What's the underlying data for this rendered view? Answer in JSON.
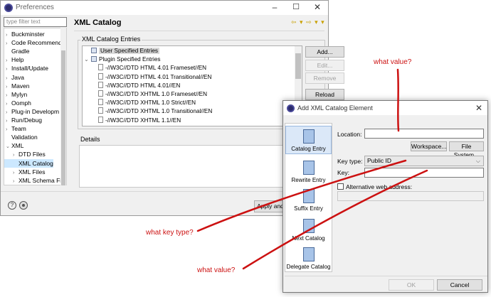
{
  "preferences": {
    "title": "Preferences",
    "filter_placeholder": "type filter text",
    "tree": [
      {
        "label": "Buckminster",
        "expandable": true
      },
      {
        "label": "Code Recommend",
        "expandable": true
      },
      {
        "label": "Gradle",
        "expandable": false
      },
      {
        "label": "Help",
        "expandable": true
      },
      {
        "label": "Install/Update",
        "expandable": true
      },
      {
        "label": "Java",
        "expandable": true
      },
      {
        "label": "Maven",
        "expandable": true
      },
      {
        "label": "Mylyn",
        "expandable": true
      },
      {
        "label": "Oomph",
        "expandable": true
      },
      {
        "label": "Plug-in Developm",
        "expandable": true
      },
      {
        "label": "Run/Debug",
        "expandable": true
      },
      {
        "label": "Team",
        "expandable": true
      },
      {
        "label": "Validation",
        "expandable": false
      },
      {
        "label": "XML",
        "expanded": true
      },
      {
        "label": "DTD Files",
        "child": true,
        "expandable": true
      },
      {
        "label": "XML Catalog",
        "child": true,
        "selected": true
      },
      {
        "label": "XML Files",
        "child": true,
        "expandable": true
      },
      {
        "label": "XML Schema Fi",
        "child": true,
        "expandable": true
      }
    ],
    "page_title": "XML Catalog",
    "catalog_group_label": "XML Catalog Entries",
    "entries": [
      {
        "label": "User Specified Entries",
        "level": 0,
        "type": "folder",
        "selected": true
      },
      {
        "label": "Plugin Specified Entries",
        "level": 0,
        "type": "folder",
        "expanded": true
      },
      {
        "label": "-//W3C//DTD HTML 4.01 Frameset//EN",
        "level": 1,
        "type": "doc"
      },
      {
        "label": "-//W3C//DTD HTML 4.01 Transitional//EN",
        "level": 1,
        "type": "doc"
      },
      {
        "label": "-//W3C//DTD HTML 4.01//EN",
        "level": 1,
        "type": "doc"
      },
      {
        "label": "-//W3C//DTD XHTML 1.0 Frameset//EN",
        "level": 1,
        "type": "doc"
      },
      {
        "label": "-//W3C//DTD XHTML 1.0 Strict//EN",
        "level": 1,
        "type": "doc"
      },
      {
        "label": "-//W3C//DTD XHTML 1.0 Transitional//EN",
        "level": 1,
        "type": "doc"
      },
      {
        "label": "-//W3C//DTD XHTML 1.1//EN",
        "level": 1,
        "type": "doc"
      }
    ],
    "buttons": {
      "add": "Add...",
      "edit": "Edit...",
      "remove": "Remove",
      "reload": "Reload Entries",
      "apply": "Apply and"
    },
    "details_label": "Details"
  },
  "dialog": {
    "title": "Add XML Catalog Element",
    "sidebar": [
      {
        "label": "Catalog Entry",
        "selected": true
      },
      {
        "label": "Rewrite Entry"
      },
      {
        "label": "Suffix Entry"
      },
      {
        "label": "Next Catalog"
      },
      {
        "label": "Delegate Catalog"
      }
    ],
    "location_label": "Location:",
    "location_value": "",
    "workspace_button": "Workspace...",
    "filesystem_button": "File System...",
    "keytype_label": "Key type:",
    "keytype_value": "Public ID",
    "key_label": "Key:",
    "key_value": "",
    "alt_web_label": "Alternative web address:",
    "ok_button": "OK",
    "cancel_button": "Cancel"
  },
  "annotations": {
    "top": "what value?",
    "middle": "what key type?",
    "bottom": "what value?",
    "color": "#cc1111"
  }
}
